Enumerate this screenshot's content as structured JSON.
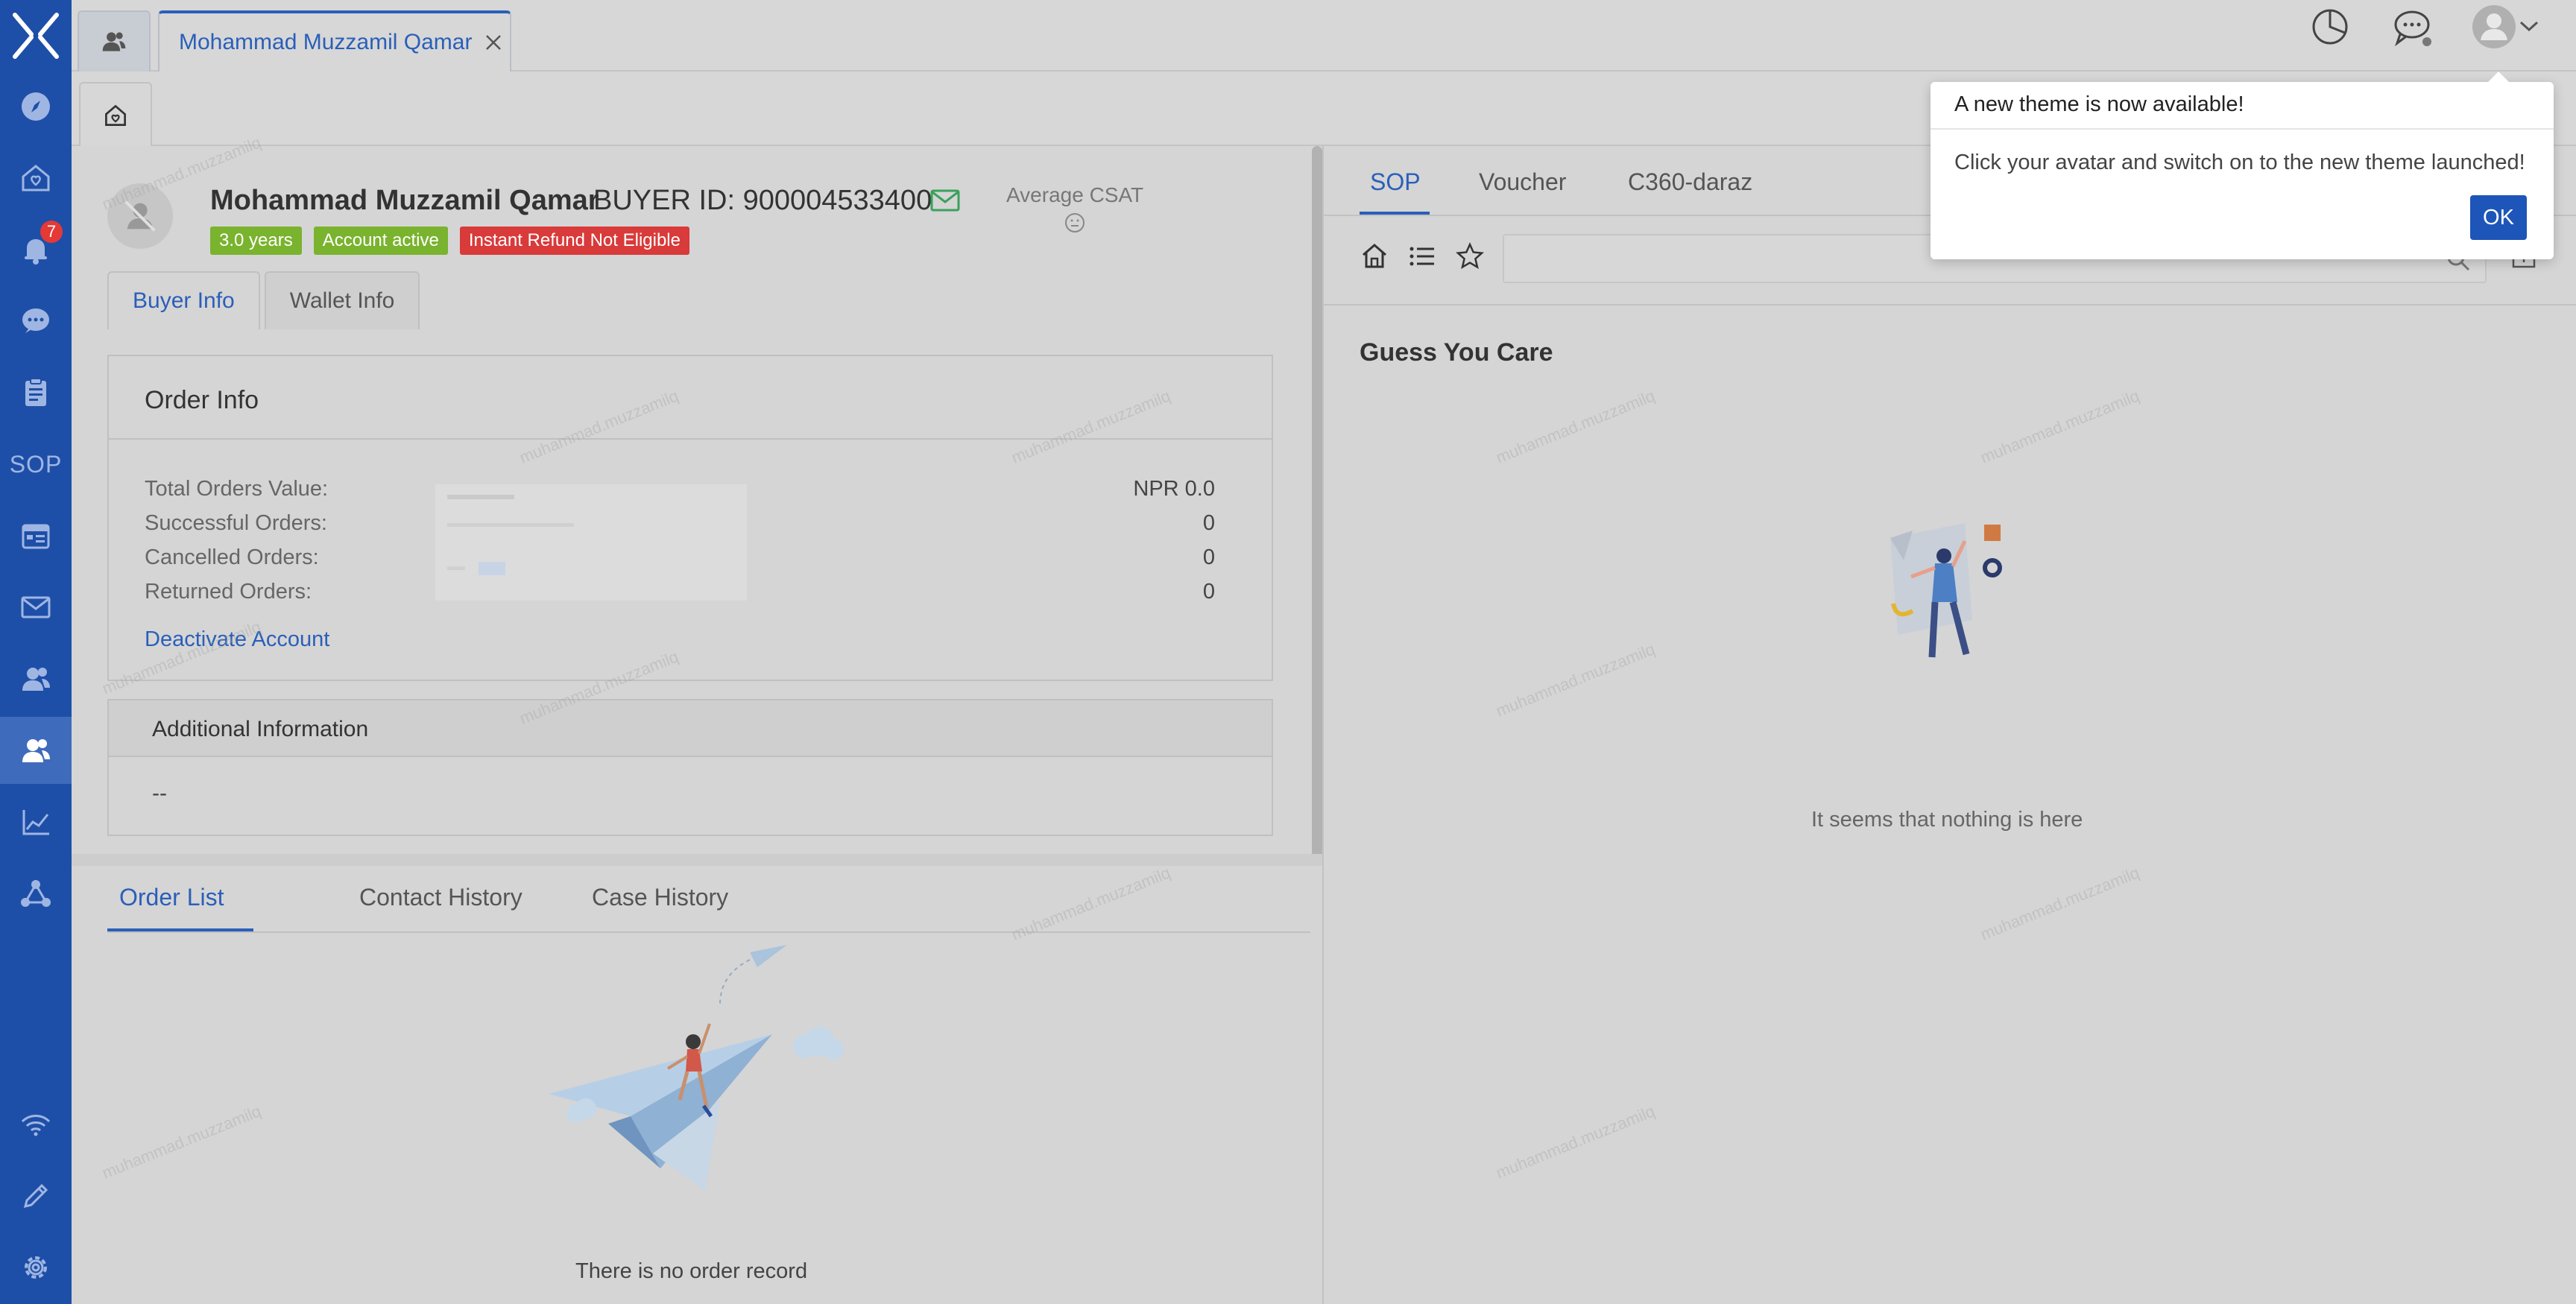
{
  "sidebar": {
    "items": [
      {
        "icon": "compass-icon"
      },
      {
        "icon": "home-icon"
      },
      {
        "icon": "bell-icon",
        "badge": "7"
      },
      {
        "icon": "chat-icon"
      },
      {
        "icon": "clipboard-icon"
      },
      {
        "icon": "sop-icon",
        "label": "SOP"
      },
      {
        "icon": "calendar-icon"
      },
      {
        "icon": "mail-icon"
      },
      {
        "icon": "users-icon"
      },
      {
        "icon": "user-icon"
      },
      {
        "icon": "chart-icon"
      },
      {
        "icon": "network-icon"
      }
    ],
    "bottom": [
      {
        "icon": "wifi-icon"
      },
      {
        "icon": "pen-icon"
      },
      {
        "icon": "gear-icon"
      }
    ],
    "accent": "#1e4fa8"
  },
  "tabs": {
    "active_label": "Mohammad Muzzamil Qamar"
  },
  "customer": {
    "name": "Mohammad Muzzamil Qamar",
    "buyer_id": "BUYER ID: 900004533400",
    "badges": [
      {
        "label": "3.0 years",
        "color": "#7ab32e"
      },
      {
        "label": "Account active",
        "color": "#7ab32e"
      },
      {
        "label": "Instant Refund Not Eligible",
        "color": "#d93a3a"
      }
    ],
    "csat_label": "Average CSAT"
  },
  "info_tabs": [
    "Buyer Info",
    "Wallet Info"
  ],
  "order_info": {
    "title": "Order Info",
    "rows": [
      {
        "label": "Total Orders Value:",
        "value": "NPR 0.0"
      },
      {
        "label": "Successful Orders:",
        "value": "0"
      },
      {
        "label": "Cancelled Orders:",
        "value": "0"
      },
      {
        "label": "Returned Orders:",
        "value": "0"
      }
    ],
    "deactivate": "Deactivate Account"
  },
  "additional": {
    "title": "Additional Information",
    "value": "--"
  },
  "bottom_tabs": [
    "Order List",
    "Contact History",
    "Case History"
  ],
  "no_order": "There is no order record",
  "right": {
    "tabs": [
      "SOP",
      "Voucher",
      "C360-daraz"
    ],
    "guess_title": "Guess You Care",
    "empty_text": "It seems that nothing is here"
  },
  "popup": {
    "title": "A new theme is now available!",
    "body": "Click your avatar and switch on to the new theme launched!",
    "ok": "OK"
  },
  "watermark": "muhammad.muzzamilq"
}
